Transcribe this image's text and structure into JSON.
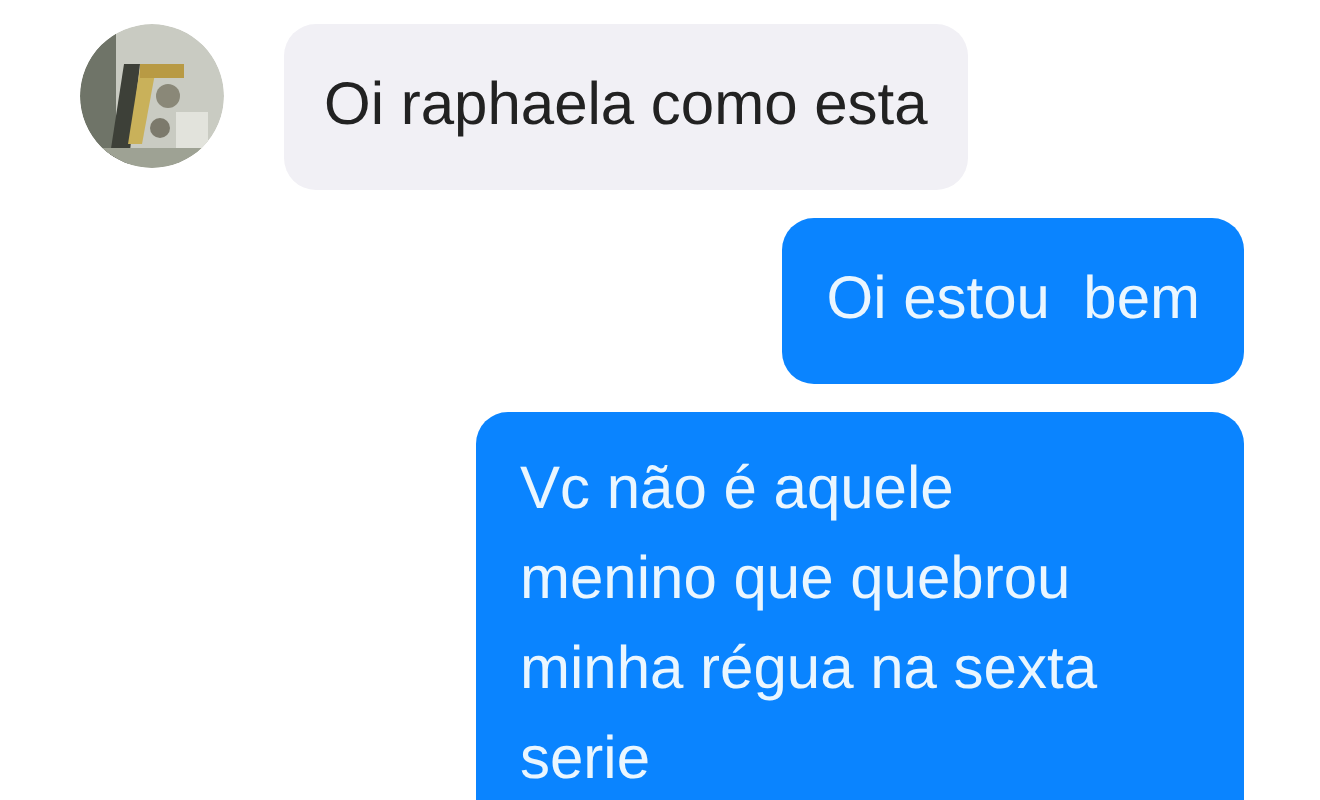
{
  "messages": [
    {
      "kind": "incoming",
      "text": "Oi raphaela como esta"
    },
    {
      "kind": "outgoing",
      "text": "Oi estou  bem"
    },
    {
      "kind": "outgoing",
      "text": "Vc não é aquele\nmenino que quebrou\nminha régua na sexta\nserie"
    }
  ]
}
